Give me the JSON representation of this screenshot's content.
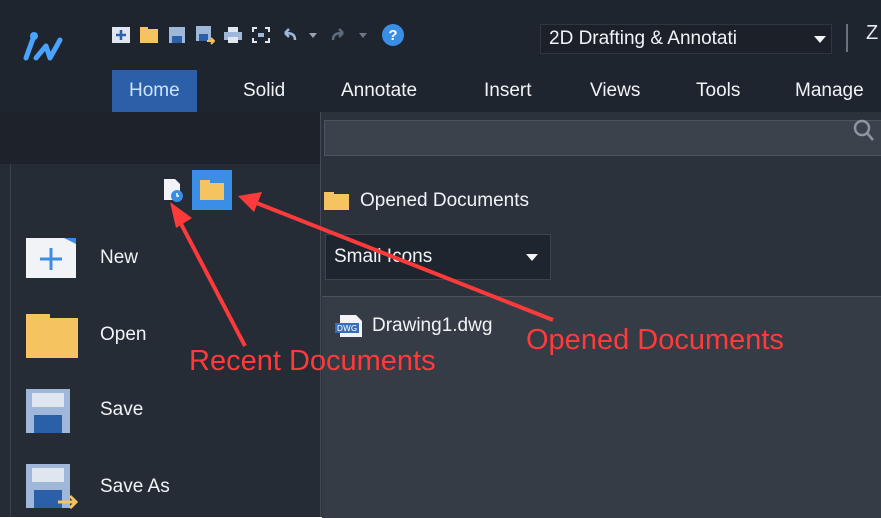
{
  "toolbar": {
    "workspace": "2D Drafting & Annotati",
    "help_label": "?",
    "cutoff_text": "Z"
  },
  "tabs": [
    {
      "label": "Home",
      "active": true
    },
    {
      "label": "Solid"
    },
    {
      "label": "Annotate"
    },
    {
      "label": "Insert"
    },
    {
      "label": "Views"
    },
    {
      "label": "Tools"
    },
    {
      "label": "Manage"
    }
  ],
  "menu": {
    "new": "New",
    "open": "Open",
    "save": "Save",
    "save_as": "Save As"
  },
  "right": {
    "search_placeholder": "",
    "section_title": "Opened Documents",
    "view_mode": "Small Icons",
    "documents": [
      {
        "name": "Drawing1.dwg",
        "icon": "dwg-file-icon"
      }
    ]
  },
  "annotations": {
    "recent": "Recent Documents",
    "opened": "Opened Documents"
  },
  "colors": {
    "annotation_red": "#ff3a3a",
    "active_tab": "#2b5fa8",
    "folder": "#f5c35f",
    "accent_blue": "#3a8ee6"
  }
}
